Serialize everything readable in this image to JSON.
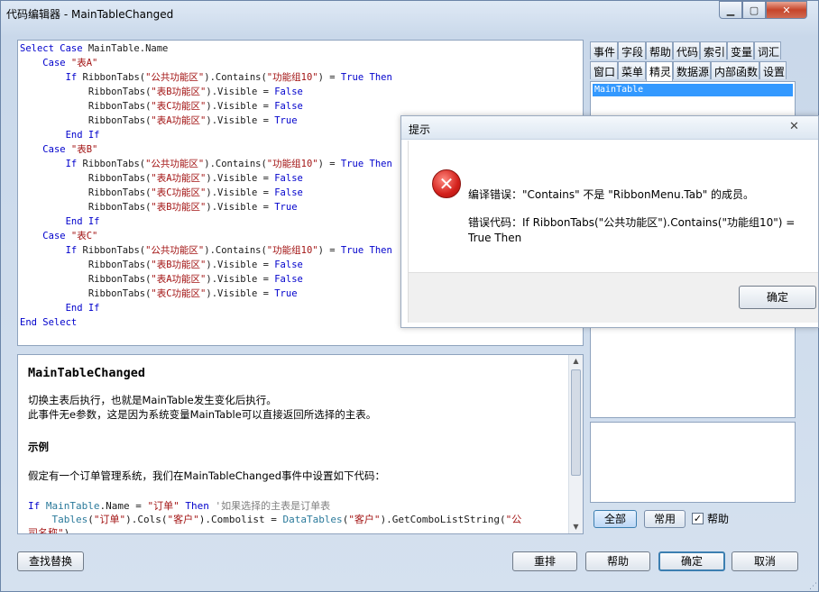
{
  "window": {
    "title": "代码编辑器 - MainTableChanged",
    "min_icon": "minimize-icon",
    "max_icon": "maximize-icon",
    "close_icon": "close-icon"
  },
  "code_lines": [
    [
      [
        "kw",
        "Select Case "
      ],
      [
        "plain",
        "MainTable.Name"
      ]
    ],
    [
      [
        "plain",
        "    "
      ],
      [
        "kw",
        "Case "
      ],
      [
        "str",
        "\"表A\""
      ]
    ],
    [
      [
        "plain",
        "        "
      ],
      [
        "kw",
        "If "
      ],
      [
        "plain",
        "RibbonTabs("
      ],
      [
        "str",
        "\"公共功能区\""
      ],
      [
        "plain",
        ").Contains("
      ],
      [
        "str",
        "\"功能组10\""
      ],
      [
        "plain",
        ") = "
      ],
      [
        "kw",
        "True Then"
      ]
    ],
    [
      [
        "plain",
        "            RibbonTabs("
      ],
      [
        "str",
        "\"表B功能区\""
      ],
      [
        "plain",
        ").Visible = "
      ],
      [
        "kw",
        "False"
      ]
    ],
    [
      [
        "plain",
        "            RibbonTabs("
      ],
      [
        "str",
        "\"表C功能区\""
      ],
      [
        "plain",
        ").Visible = "
      ],
      [
        "kw",
        "False"
      ]
    ],
    [
      [
        "plain",
        "            RibbonTabs("
      ],
      [
        "str",
        "\"表A功能区\""
      ],
      [
        "plain",
        ").Visible = "
      ],
      [
        "kw",
        "True"
      ]
    ],
    [
      [
        "plain",
        "        "
      ],
      [
        "kw",
        "End If"
      ]
    ],
    [
      [
        "plain",
        "    "
      ],
      [
        "kw",
        "Case "
      ],
      [
        "str",
        "\"表B\""
      ]
    ],
    [
      [
        "plain",
        "        "
      ],
      [
        "kw",
        "If "
      ],
      [
        "plain",
        "RibbonTabs("
      ],
      [
        "str",
        "\"公共功能区\""
      ],
      [
        "plain",
        ").Contains("
      ],
      [
        "str",
        "\"功能组10\""
      ],
      [
        "plain",
        ") = "
      ],
      [
        "kw",
        "True Then"
      ]
    ],
    [
      [
        "plain",
        "            RibbonTabs("
      ],
      [
        "str",
        "\"表A功能区\""
      ],
      [
        "plain",
        ").Visible = "
      ],
      [
        "kw",
        "False"
      ]
    ],
    [
      [
        "plain",
        "            RibbonTabs("
      ],
      [
        "str",
        "\"表C功能区\""
      ],
      [
        "plain",
        ").Visible = "
      ],
      [
        "kw",
        "False"
      ]
    ],
    [
      [
        "plain",
        "            RibbonTabs("
      ],
      [
        "str",
        "\"表B功能区\""
      ],
      [
        "plain",
        ").Visible = "
      ],
      [
        "kw",
        "True"
      ]
    ],
    [
      [
        "plain",
        "        "
      ],
      [
        "kw",
        "End If"
      ]
    ],
    [
      [
        "plain",
        "    "
      ],
      [
        "kw",
        "Case "
      ],
      [
        "str",
        "\"表C\""
      ]
    ],
    [
      [
        "plain",
        "        "
      ],
      [
        "kw",
        "If "
      ],
      [
        "plain",
        "RibbonTabs("
      ],
      [
        "str",
        "\"公共功能区\""
      ],
      [
        "plain",
        ").Contains("
      ],
      [
        "str",
        "\"功能组10\""
      ],
      [
        "plain",
        ") = "
      ],
      [
        "kw",
        "True Then"
      ]
    ],
    [
      [
        "plain",
        "            RibbonTabs("
      ],
      [
        "str",
        "\"表B功能区\""
      ],
      [
        "plain",
        ").Visible = "
      ],
      [
        "kw",
        "False"
      ]
    ],
    [
      [
        "plain",
        "            RibbonTabs("
      ],
      [
        "str",
        "\"表A功能区\""
      ],
      [
        "plain",
        ").Visible = "
      ],
      [
        "kw",
        "False"
      ]
    ],
    [
      [
        "plain",
        "            RibbonTabs("
      ],
      [
        "str",
        "\"表C功能区\""
      ],
      [
        "plain",
        ").Visible = "
      ],
      [
        "kw",
        "True"
      ]
    ],
    [
      [
        "plain",
        "        "
      ],
      [
        "kw",
        "End If"
      ]
    ],
    [
      [
        "kw",
        "End Select"
      ]
    ]
  ],
  "help": {
    "heading": "MainTableChanged",
    "p1": "切换主表后执行，也就是MainTable发生变化后执行。",
    "p2": "此事件无e参数，这是因为系统变量MainTable可以直接返回所选择的主表。",
    "example_title": "示例",
    "p3": "假定有一个订单管理系统，我们在MainTableChanged事件中设置如下代码：",
    "code": [
      [
        [
          "kw",
          "If "
        ],
        [
          "cls",
          "MainTable"
        ],
        [
          "plain",
          ".Name = "
        ],
        [
          "str",
          "\"订单\""
        ],
        [
          "plain",
          " "
        ],
        [
          "kw",
          "Then"
        ],
        [
          "cmt",
          " '如果选择的主表是订单表"
        ]
      ],
      [
        [
          "plain",
          "    "
        ],
        [
          "cls",
          "Tables"
        ],
        [
          "plain",
          "("
        ],
        [
          "str",
          "\"订单\""
        ],
        [
          "plain",
          ").Cols("
        ],
        [
          "str",
          "\"客户\""
        ],
        [
          "plain",
          ").Combolist = "
        ],
        [
          "cls",
          "DataTables"
        ],
        [
          "plain",
          "("
        ],
        [
          "str",
          "\"客户\""
        ],
        [
          "plain",
          ").GetComboListString("
        ],
        [
          "str",
          "\"公"
        ]
      ],
      [
        [
          "str",
          "司名称\""
        ],
        [
          "plain",
          ")"
        ]
      ]
    ]
  },
  "right_panel": {
    "tabs_row1": [
      "事件",
      "字段",
      "帮助",
      "代码",
      "索引",
      "变量",
      "词汇"
    ],
    "tabs_row2": [
      "窗口",
      "菜单",
      "精灵",
      "数据源",
      "内部函数",
      "设置"
    ],
    "active_tab": "精灵",
    "list_selected": "MainTable",
    "all_btn": "全部",
    "common_btn": "常用",
    "help_check_label": "帮助",
    "help_checked": "✓"
  },
  "bottom_buttons": {
    "find_replace": "查找替换",
    "rearrange": "重排",
    "help": "帮助",
    "ok": "确定",
    "cancel": "取消"
  },
  "dialog": {
    "title": "提示",
    "close_glyph": "✕",
    "icon_glyph": "✕",
    "message": "编译错误：\"Contains\" 不是 \"RibbonMenu.Tab\" 的成员。",
    "code_line": "错误代码：If RibbonTabs(\"公共功能区\").Contains(\"功能组10\") = True Then",
    "ok": "确定"
  }
}
